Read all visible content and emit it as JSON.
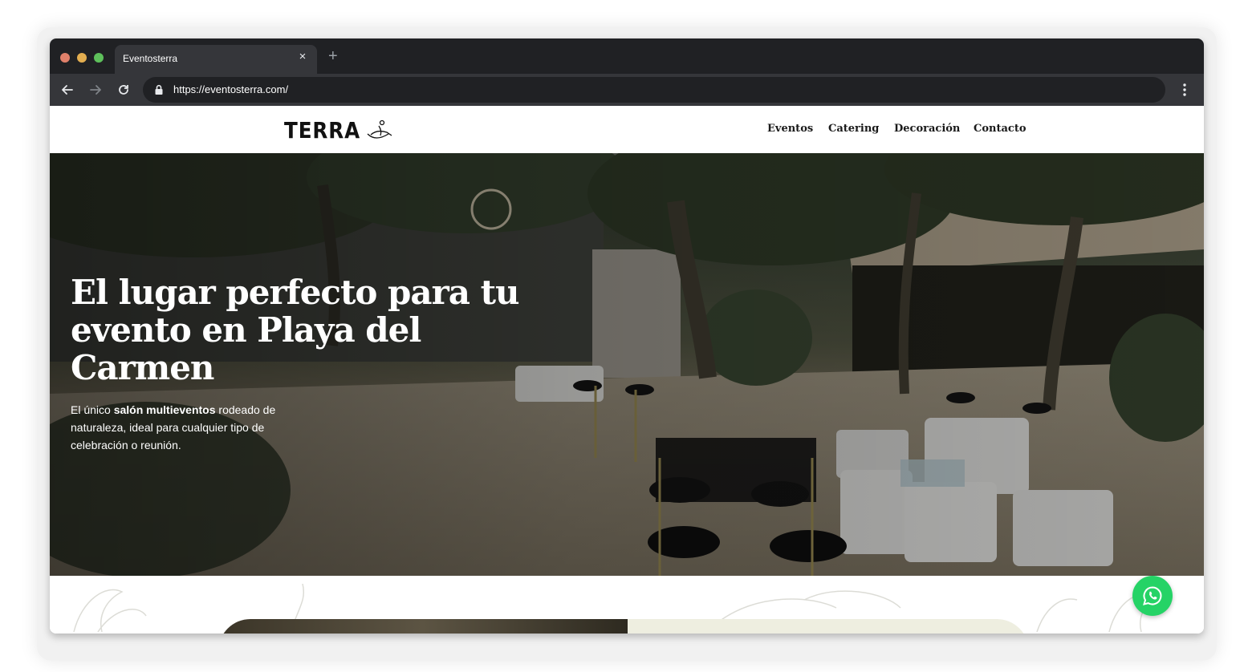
{
  "browser": {
    "tab_title": "Eventosterra",
    "url": "https://eventosterra.com/",
    "new_tab_symbol": "+",
    "close_symbol": "×"
  },
  "site": {
    "logo_text": "TERRA",
    "nav": [
      "Eventos",
      "Catering",
      "Decoración",
      "Contacto"
    ]
  },
  "hero": {
    "title": "El lugar perfecto para tu evento en Playa del Carmen",
    "subtitle_prefix": "El único ",
    "subtitle_bold": "salón multieventos",
    "subtitle_suffix": " rodeado de naturaleza, ideal para cualquier tipo de celebración o reunión."
  },
  "icons": {
    "back": "arrow-left-icon",
    "forward": "arrow-right-icon",
    "reload": "reload-icon",
    "lock": "lock-icon",
    "menu": "kebab-menu-icon",
    "whatsapp": "whatsapp-icon"
  },
  "colors": {
    "titlebar": "#202124",
    "toolbar": "#35363a",
    "whatsapp": "#25d366",
    "cream": "#eeeee0"
  }
}
